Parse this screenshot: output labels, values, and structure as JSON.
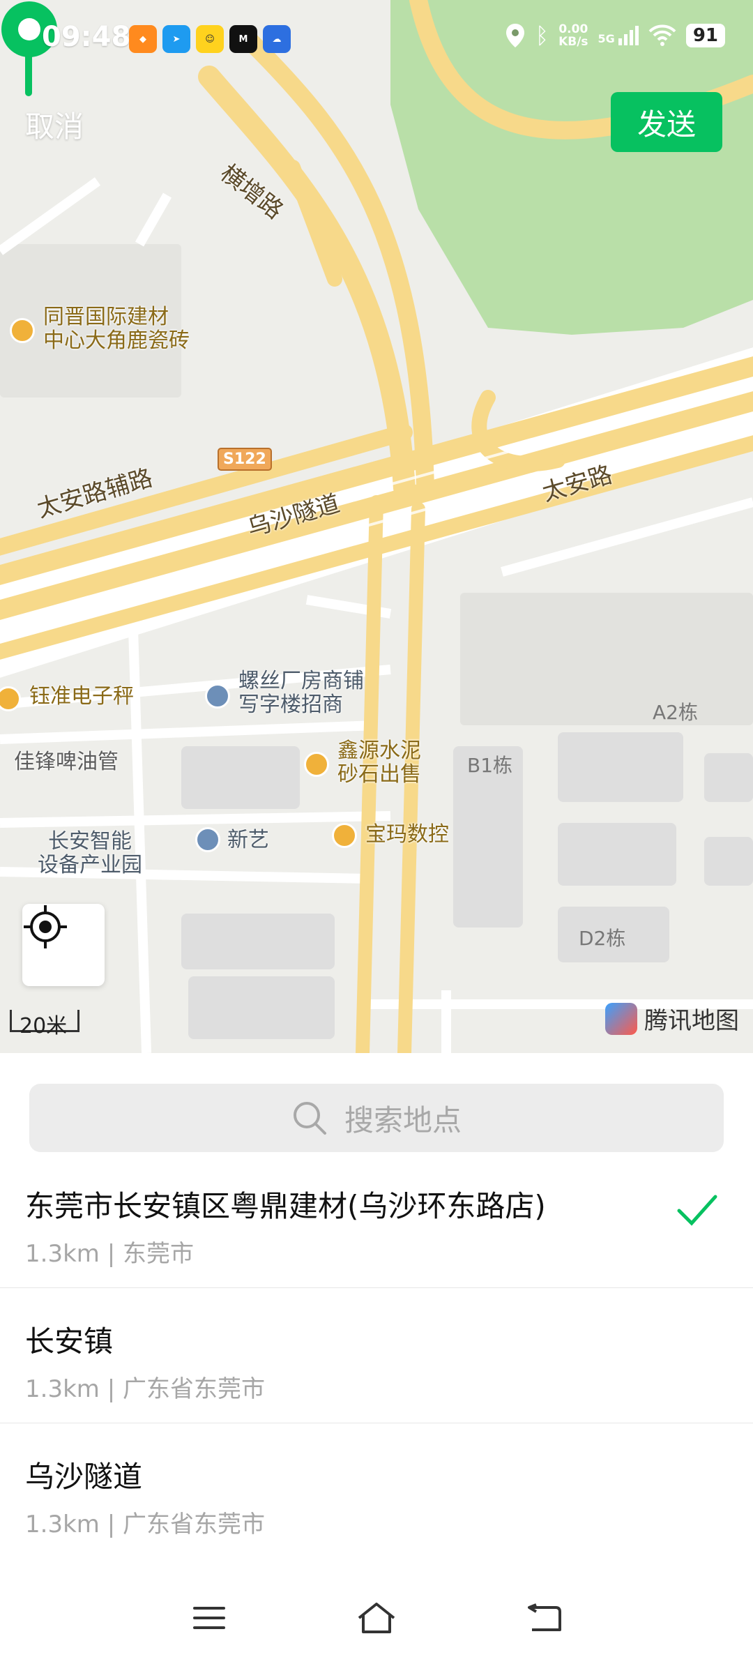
{
  "status_bar": {
    "time": "09:48",
    "net_speed": "0.00",
    "net_unit": "KB/s",
    "net_type": "5G",
    "battery": "91"
  },
  "header": {
    "cancel_label": "取消",
    "send_label": "发送"
  },
  "map": {
    "roads": {
      "hengzeng": "横增路",
      "taian_aux": "太安路辅路",
      "wusha_tunnel": "乌沙隧道",
      "taian": "太安路",
      "s122": "S122"
    },
    "pois": {
      "tongjin": [
        "同晋国际建材",
        "中心大角鹿瓷砖"
      ],
      "yuzhun": "钰准电子秤",
      "luosi": [
        "螺丝厂房商铺",
        "写字楼招商"
      ],
      "jiafeng": "佳锋啤油管",
      "xinyuan": [
        "鑫源水泥",
        "砂石出售"
      ],
      "zhineng": [
        "长安智能",
        "设备产业园"
      ],
      "xinyi": "新艺",
      "baoma": "宝玛数控"
    },
    "buildings": {
      "a2": "A2栋",
      "b1": "B1栋",
      "d2": "D2栋"
    },
    "scale": "20米",
    "provider": "腾讯地图"
  },
  "search": {
    "placeholder": "搜索地点"
  },
  "results": [
    {
      "title": "东莞市长安镇区粤鼎建材(乌沙环东路店)",
      "subtitle": "1.3km | 东莞市",
      "selected": true
    },
    {
      "title": "长安镇",
      "subtitle": "1.3km | 广东省东莞市",
      "selected": false
    },
    {
      "title": "乌沙隧道",
      "subtitle": "1.3km | 广东省东莞市",
      "selected": false
    }
  ],
  "colors": {
    "accent": "#07c160",
    "road": "#f7d98a",
    "park": "#b9dfa8"
  }
}
